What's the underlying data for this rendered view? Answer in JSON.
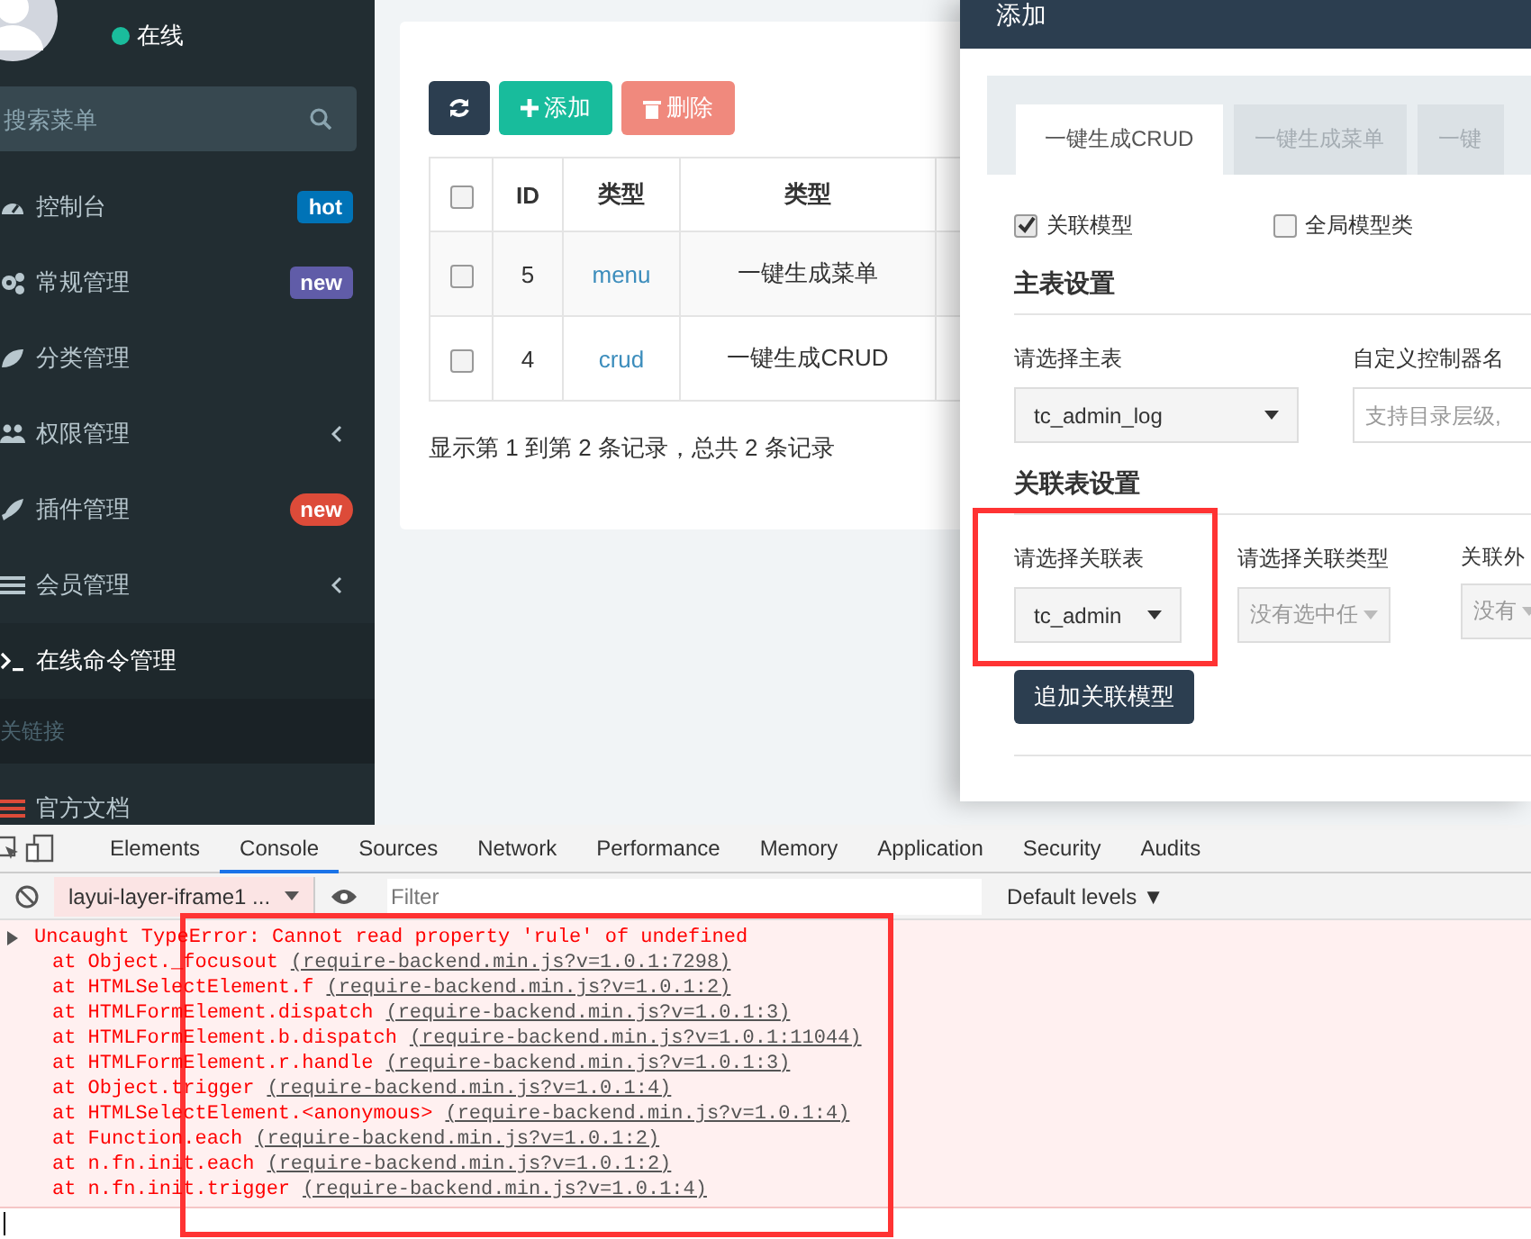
{
  "sidebar": {
    "status": "在线",
    "search": {
      "placeholder": "搜索菜单"
    },
    "items": [
      {
        "label": "控制台",
        "selected": false,
        "badge": {
          "text": "hot",
          "color": "#0073b7",
          "kind": "label"
        }
      },
      {
        "label": "常规管理",
        "selected": false,
        "badge": {
          "text": "new",
          "color": "#605ca8",
          "kind": "label"
        }
      },
      {
        "label": "分类管理",
        "selected": false
      },
      {
        "label": "权限管理",
        "selected": false,
        "expandable": true
      },
      {
        "label": "插件管理",
        "selected": false,
        "badge": {
          "text": "new",
          "color": "#dd4b39",
          "kind": "pill"
        }
      },
      {
        "label": "会员管理",
        "selected": false,
        "expandable": true
      },
      {
        "label": "在线命令管理",
        "selected": true
      }
    ],
    "header": "关链接",
    "links": [
      {
        "label": "官方文档"
      }
    ]
  },
  "toolbar": {
    "buttons": [
      {
        "kind": "refresh"
      },
      {
        "kind": "add",
        "label": "添加"
      },
      {
        "kind": "delete",
        "label": "删除"
      }
    ]
  },
  "table": {
    "select_all": {
      "checked": false
    },
    "columns": [
      "ID",
      "类型",
      "类型"
    ],
    "rows": [
      {
        "checked": false,
        "cells": [
          "5",
          "menu",
          "一键生成菜单"
        ]
      },
      {
        "checked": false,
        "cells": [
          "4",
          "crud",
          "一键生成CRUD"
        ]
      }
    ],
    "footer": "显示第 1 到第 2 条记录，总共 2 条记录"
  },
  "modal": {
    "title": "添加",
    "tabs": [
      {
        "label": "一键生成CRUD",
        "selected": true
      },
      {
        "label": "一键生成菜单",
        "selected": false
      },
      {
        "label": "一键",
        "selected": false
      }
    ],
    "options": [
      {
        "label": "关联模型",
        "checked": true
      },
      {
        "label": "全局模型类",
        "checked": false
      }
    ],
    "main_section": "主表设置",
    "main_fields": [
      {
        "label": "请选择主表",
        "kind": "select",
        "value": "tc_admin_log"
      },
      {
        "label": "自定义控制器名",
        "kind": "input",
        "placeholder": "支持目录层级,"
      }
    ],
    "relation_section": "关联表设置",
    "relation_fields": [
      {
        "label": "请选择关联表",
        "kind": "select",
        "value": "tc_admin"
      },
      {
        "label": "请选择关联类型",
        "kind": "select",
        "value": "没有选中任",
        "disabled": true
      },
      {
        "label": "关联外",
        "kind": "select",
        "value": "没有",
        "disabled": true
      }
    ],
    "add_button": "追加关联模型"
  },
  "devtools": {
    "tabs": [
      {
        "label": "Elements",
        "selected": false
      },
      {
        "label": "Console",
        "selected": true
      },
      {
        "label": "Sources",
        "selected": false
      },
      {
        "label": "Network",
        "selected": false
      },
      {
        "label": "Performance",
        "selected": false
      },
      {
        "label": "Memory",
        "selected": false
      },
      {
        "label": "Application",
        "selected": false
      },
      {
        "label": "Security",
        "selected": false
      },
      {
        "label": "Audits",
        "selected": false
      }
    ],
    "context": "layui-layer-iframe1 ...",
    "filter_placeholder": "Filter",
    "levels": "Default levels ▼",
    "error": {
      "message": "Uncaught TypeError: Cannot read property 'rule' of undefined",
      "stack": [
        {
          "at": "at Object._focusout",
          "link": "(require-backend.min.js?v=1.0.1:7298)"
        },
        {
          "at": "at HTMLSelectElement.f",
          "link": "(require-backend.min.js?v=1.0.1:2)"
        },
        {
          "at": "at HTMLFormElement.dispatch",
          "link": "(require-backend.min.js?v=1.0.1:3)"
        },
        {
          "at": "at HTMLFormElement.b.dispatch",
          "link": "(require-backend.min.js?v=1.0.1:11044)"
        },
        {
          "at": "at HTMLFormElement.r.handle",
          "link": "(require-backend.min.js?v=1.0.1:3)"
        },
        {
          "at": "at Object.trigger",
          "link": "(require-backend.min.js?v=1.0.1:4)"
        },
        {
          "at": "at HTMLSelectElement.<anonymous>",
          "link": "(require-backend.min.js?v=1.0.1:4)"
        },
        {
          "at": "at Function.each",
          "link": "(require-backend.min.js?v=1.0.1:2)"
        },
        {
          "at": "at n.fn.init.each",
          "link": "(require-backend.min.js?v=1.0.1:2)"
        },
        {
          "at": "at n.fn.init.trigger",
          "link": "(require-backend.min.js?v=1.0.1:4)"
        }
      ]
    }
  }
}
